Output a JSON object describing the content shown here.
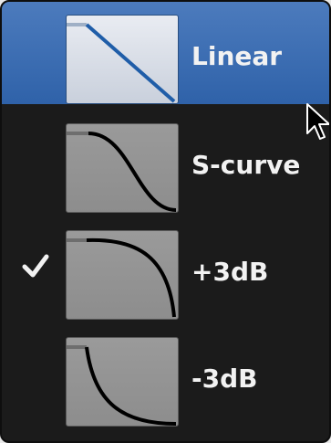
{
  "menu": {
    "items": [
      {
        "label": "Linear",
        "icon": "fade-linear-icon",
        "selected": true,
        "checked": false
      },
      {
        "label": "S-curve",
        "icon": "fade-s-curve-icon",
        "selected": false,
        "checked": false
      },
      {
        "label": "+3dB",
        "icon": "fade-plus-3db-icon",
        "selected": false,
        "checked": true
      },
      {
        "label": "-3dB",
        "icon": "fade-minus-3db-icon",
        "selected": false,
        "checked": false
      }
    ],
    "check_icon": "checkmark-icon"
  },
  "colors": {
    "highlight": "#3a6fb5",
    "menu_background": "#1b1b1b",
    "text": "#f2f2f2"
  },
  "cursor": {
    "icon": "mouse-pointer-icon"
  }
}
